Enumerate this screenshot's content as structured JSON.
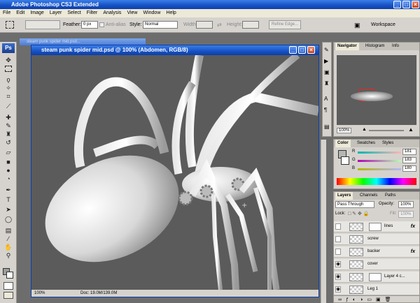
{
  "app": {
    "title": "Adobe Photoshop CS3 Extended"
  },
  "menu": [
    "File",
    "Edit",
    "Image",
    "Layer",
    "Select",
    "Filter",
    "Analysis",
    "View",
    "Window",
    "Help"
  ],
  "options": {
    "feather_label": "Feather:",
    "feather_value": "0 px",
    "antialias_label": "Anti-alias",
    "style_label": "Style:",
    "style_value": "Normal",
    "width_label": "Width:",
    "height_label": "Height:",
    "refine_label": "Refine Edge...",
    "workspace_label": "Workspace"
  },
  "document": {
    "title": "steam punk spider mid.psd @ 100% (Abdomen, RGB/8)",
    "bg_title": "steam punk spider mid.psd...",
    "zoom": "100%",
    "doc_info": "Doc: 19.0M/139.0M"
  },
  "navigator": {
    "tabs": [
      "Navigator",
      "Histogram",
      "Info"
    ],
    "zoom": "100%"
  },
  "color": {
    "tabs": [
      "Color",
      "Swatches",
      "Styles"
    ],
    "r_label": "R",
    "r_value": "181",
    "g_label": "G",
    "g_value": "183",
    "b_label": "B",
    "b_value": "180",
    "colors": {
      "fg": "#b5b7b4",
      "bg": "#ffffff"
    }
  },
  "layers": {
    "tabs": [
      "Layers",
      "Channels",
      "Paths"
    ],
    "blend_mode": "Pass Through",
    "opacity_label": "Opacity:",
    "opacity_value": "100%",
    "lock_label": "Lock:",
    "fill_label": "Fill:",
    "fill_value": "100%",
    "rows": [
      {
        "name": "lines",
        "fx": "fx"
      },
      {
        "name": "screw",
        "fx": ""
      },
      {
        "name": "backer",
        "fx": "fx"
      },
      {
        "name": "cover",
        "fx": ""
      },
      {
        "name": "Layer 4 c...",
        "fx": ""
      },
      {
        "name": "Leg 1",
        "fx": ""
      }
    ]
  }
}
